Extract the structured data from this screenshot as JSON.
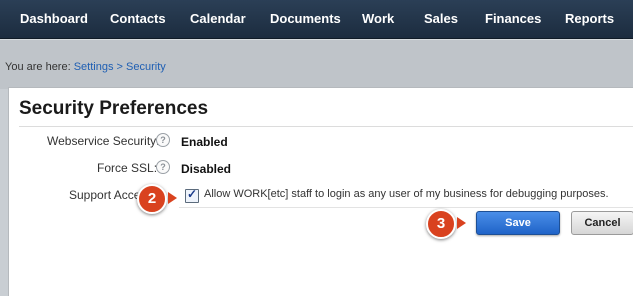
{
  "nav": {
    "items": [
      "Dashboard",
      "Contacts",
      "Calendar",
      "Documents",
      "Work",
      "Sales",
      "Finances",
      "Reports"
    ]
  },
  "breadcrumb": {
    "prefix": "You are here:",
    "settings": "Settings",
    "separator": ">",
    "current": "Security"
  },
  "page": {
    "title": "Security Preferences"
  },
  "rows": {
    "webservice": {
      "label": "Webservice Security:",
      "value": "Enabled"
    },
    "ssl": {
      "label": "Force SSL:",
      "value": "Disabled"
    },
    "support": {
      "label": "Support Access:",
      "checked": true,
      "text": "Allow WORK[etc] staff to login as any user of my business for debugging purposes."
    }
  },
  "help_icon_glyph": "?",
  "buttons": {
    "save": "Save",
    "cancel": "Cancel"
  },
  "annotations": {
    "step2": "2",
    "step3": "3"
  },
  "colors": {
    "nav_bg": "#1f3046",
    "link": "#1f5fb3",
    "save_button": "#2f74d6",
    "badge": "#d9421f"
  },
  "icons": {
    "help": "help-icon",
    "checkbox": "checkbox-checked"
  }
}
